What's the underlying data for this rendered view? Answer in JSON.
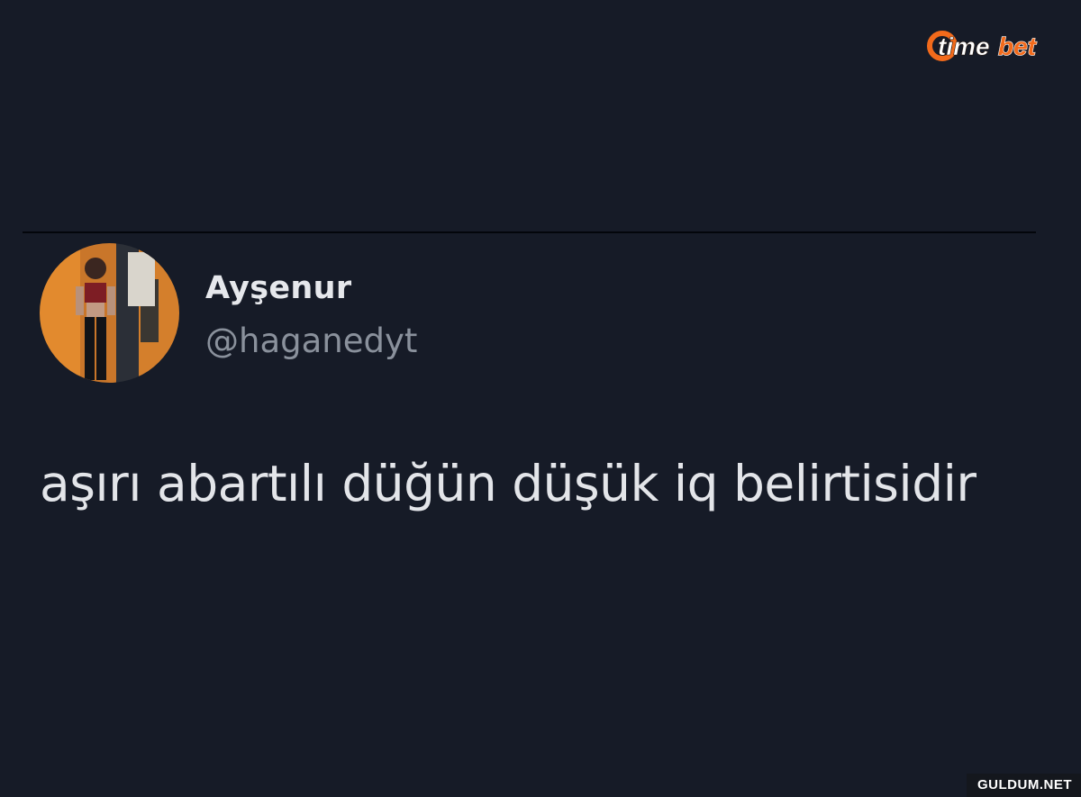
{
  "brand": {
    "logo_prefix": "time",
    "logo_suffix": "bet",
    "prefix_color": "#ffffff",
    "suffix_color": "#f26a1b"
  },
  "tweet": {
    "display_name": "Ayşenur",
    "handle": "@haganedyt",
    "text": "aşırı abartılı düğün düşük iq belirtisidir"
  },
  "watermark": {
    "text": "GULDUM.NET"
  },
  "colors": {
    "background": "#161b27",
    "accent": "#f26a1b",
    "name": "#e6e8ec",
    "handle": "#8a919c"
  }
}
